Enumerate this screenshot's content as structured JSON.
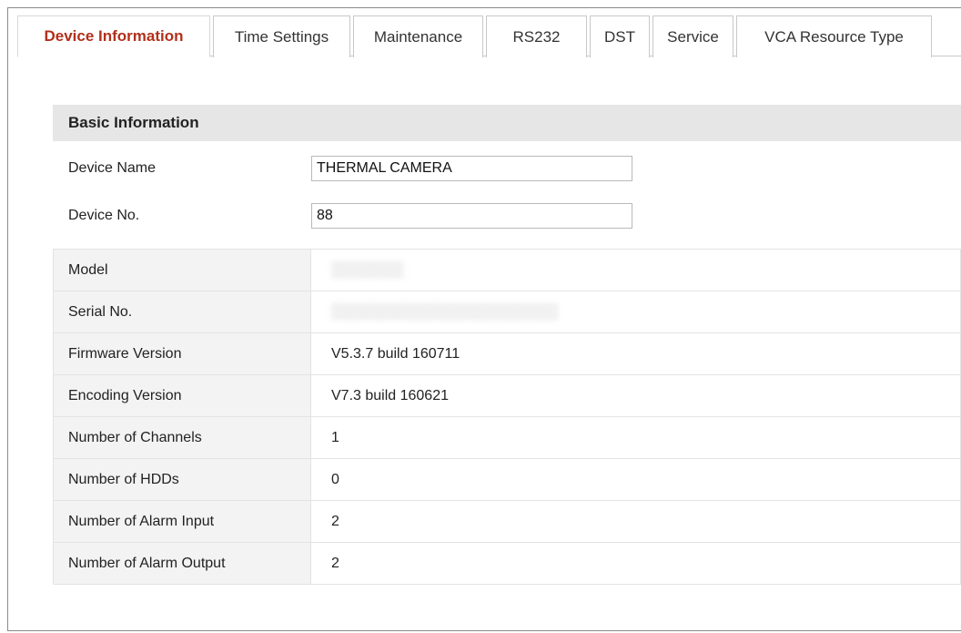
{
  "tabs": [
    {
      "label": "Device Information",
      "active": true
    },
    {
      "label": "Time Settings",
      "active": false
    },
    {
      "label": "Maintenance",
      "active": false
    },
    {
      "label": "RS232",
      "active": false
    },
    {
      "label": "DST",
      "active": false
    },
    {
      "label": "Service",
      "active": false
    },
    {
      "label": "VCA Resource Type",
      "active": false
    }
  ],
  "section": {
    "title": "Basic Information"
  },
  "fields": {
    "device_name": {
      "label": "Device Name",
      "value": "THERMAL CAMERA"
    },
    "device_no": {
      "label": "Device No.",
      "value": "88"
    }
  },
  "info": [
    {
      "label": "Model",
      "value": "",
      "redacted": true
    },
    {
      "label": "Serial No.",
      "value": "",
      "redacted": true
    },
    {
      "label": "Firmware Version",
      "value": "V5.3.7 build 160711"
    },
    {
      "label": "Encoding Version",
      "value": "V7.3 build 160621"
    },
    {
      "label": "Number of Channels",
      "value": "1"
    },
    {
      "label": "Number of HDDs",
      "value": "0"
    },
    {
      "label": "Number of Alarm Input",
      "value": "2"
    },
    {
      "label": "Number of Alarm Output",
      "value": "2"
    }
  ],
  "colors": {
    "active_tab_text": "#b2301b",
    "section_header_bg": "#e6e6e6",
    "label_cell_bg": "#f3f3f3"
  }
}
